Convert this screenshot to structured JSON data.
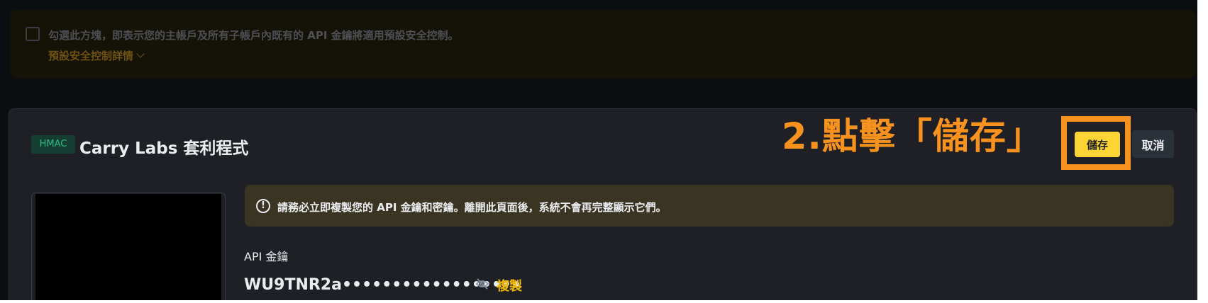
{
  "notice": {
    "checkbox_text": "勾選此方塊，即表示您的主帳戶及所有子帳戶內既有的 API 金鑰將適用預設安全控制。",
    "details_link": "預設安全控制詳情"
  },
  "key_card": {
    "badge": "HMAC",
    "title": "Carry Labs 套利程式",
    "save_label": "儲存",
    "cancel_label": "取消",
    "warning_text": "請務必立即複製您的 API 金鑰和密鑰。離開此頁面後，系統不會再完整顯示它們。",
    "api_key_label": "API 金鑰",
    "api_key_value": "WU9TNR2a••••••••••••••••••",
    "copy_label": "複製"
  },
  "annotation": {
    "text": "2.點擊「儲存」"
  },
  "colors": {
    "accent_yellow": "#fcd535",
    "link_yellow": "#f0b90b",
    "annotation_orange": "#f7921f",
    "badge_green": "#2ebd85"
  }
}
